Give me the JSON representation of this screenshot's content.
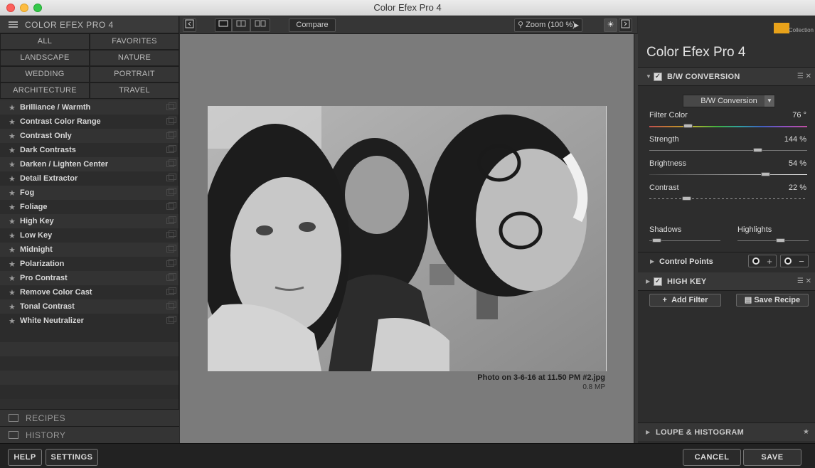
{
  "window": {
    "title": "Color Efex Pro 4"
  },
  "left": {
    "header": "COLOR EFEX PRO 4",
    "categories": [
      "ALL",
      "FAVORITES",
      "LANDSCAPE",
      "NATURE",
      "WEDDING",
      "PORTRAIT",
      "ARCHITECTURE",
      "TRAVEL"
    ],
    "filters": [
      "Brilliance / Warmth",
      "Contrast Color Range",
      "Contrast Only",
      "Dark Contrasts",
      "Darken / Lighten Center",
      "Detail Extractor",
      "Fog",
      "Foliage",
      "High Key",
      "Low Key",
      "Midnight",
      "Polarization",
      "Pro Contrast",
      "Remove Color Cast",
      "Tonal Contrast",
      "White Neutralizer"
    ],
    "recipes_label": "RECIPES",
    "history_label": "HISTORY"
  },
  "toolbar": {
    "compare_label": "Compare",
    "zoom_label": "Zoom (100 %)"
  },
  "preview": {
    "filename": "Photo on 3-6-16 at 11.50 PM #2.jpg",
    "size": "0.8 MP"
  },
  "right": {
    "brand_collection": "Collection",
    "brand_title": "Color Efex Pro",
    "brand_version": "4",
    "bw": {
      "title": "B/W CONVERSION",
      "dropdown": "B/W Conversion",
      "filter_color_label": "Filter Color",
      "filter_color_value": "76 °",
      "strength_label": "Strength",
      "strength_value": "144 %",
      "brightness_label": "Brightness",
      "brightness_value": "54 %",
      "contrast_label": "Contrast",
      "contrast_value": "22 %",
      "shadows_label": "Shadows",
      "highlights_label": "Highlights",
      "control_points_label": "Control Points",
      "levels": {
        "filter_color": 0.23,
        "strength": 0.7,
        "brightness": 0.75,
        "contrast": 0.22,
        "shadows": 0.05,
        "highlights": 0.62
      }
    },
    "highkey": {
      "title": "HIGH KEY"
    },
    "add_filter_label": "Add Filter",
    "save_recipe_label": "Save Recipe",
    "loupe_label": "LOUPE & HISTOGRAM"
  },
  "bottom": {
    "help": "HELP",
    "settings": "SETTINGS",
    "cancel": "CANCEL",
    "save": "SAVE"
  }
}
